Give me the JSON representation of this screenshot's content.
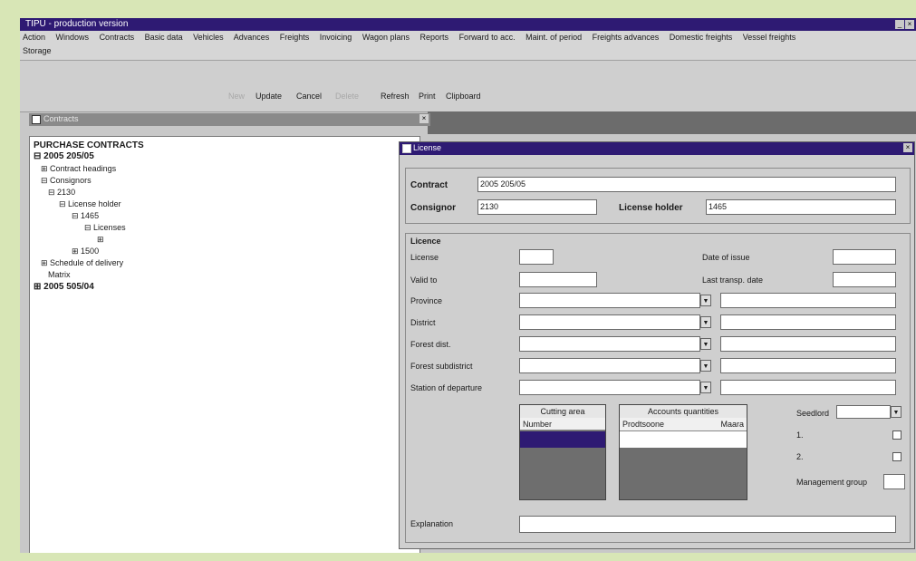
{
  "window": {
    "title": "TIPU - production version"
  },
  "menu": {
    "items": [
      "Action",
      "Windows",
      "Contracts",
      "Basic data",
      "Vehicles",
      "Advances",
      "Freights",
      "Invoicing",
      "Wagon plans",
      "Reports",
      "Forward to acc.",
      "Maint. of period",
      "Freights advances",
      "Domestic freights",
      "Vessel freights"
    ],
    "row2": "Storage"
  },
  "toolbar": {
    "new": "New",
    "update": "Update",
    "cancel": "Cancel",
    "delete": "Delete",
    "refresh": "Refresh",
    "print": "Print",
    "clipboard": "Clipboard"
  },
  "tree_panel": {
    "title": "Contracts"
  },
  "tree": {
    "root": "PURCHASE CONTRACTS",
    "contract1": "2005 205/05",
    "contract_headings": "Contract headings",
    "consignors": "Consignors",
    "consignor_2130": "2130",
    "license_holder": "License holder",
    "holder_1465": "1465",
    "licenses": "Licenses",
    "license_blank": "",
    "holder_1500": "1500",
    "schedule": "Schedule of delivery",
    "matrix": "Matrix",
    "contract2": "2005 505/04"
  },
  "license_dialog": {
    "title": "License",
    "contract_label": "Contract",
    "contract_value": "2005 205/05",
    "consignor_label": "Consignor",
    "consignor_value": "2130",
    "license_holder_label": "License holder",
    "license_holder_value": "1465",
    "section_title": "Licence",
    "license_label": "License",
    "date_of_issue_label": "Date of issue",
    "valid_to_label": "Valid to",
    "last_transp_date_label": "Last transp. date",
    "province_label": "Province",
    "district_label": "District",
    "forest_dist_label": "Forest dist.",
    "forest_subdistrict_label": "Forest subdistrict",
    "station_label": "Station of departure",
    "cutting_area_header": "Cutting area",
    "cutting_area_col": "Number",
    "accounts_header": "Accounts quantities",
    "accounts_col1": "Prodtsoone",
    "accounts_col2": "Maara",
    "seedlord_label": "Seedlord",
    "cb1_label": "1.",
    "cb2_label": "2.",
    "management_group_label": "Management group",
    "explanation_label": "Explanation"
  },
  "colors": {
    "titlebar": "#2e1a73",
    "selection": "#2e1a73",
    "background": "#d8e6b6"
  },
  "icons": [
    "close-icon",
    "dropdown-arrow-icon",
    "window-icon"
  ]
}
